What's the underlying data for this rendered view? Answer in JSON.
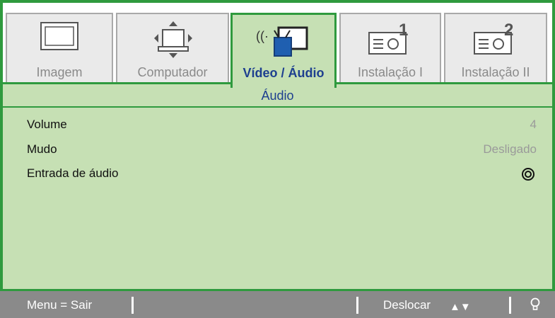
{
  "tabs": [
    {
      "label": "Imagem",
      "icon": "monitor-icon",
      "active": false
    },
    {
      "label": "Computador",
      "icon": "computer-icon",
      "active": false
    },
    {
      "label": "Vídeo / Áudio",
      "icon": "video-audio-icon",
      "active": true
    },
    {
      "label": "Instalação I",
      "icon": "projector-setup-1-icon",
      "active": false
    },
    {
      "label": "Instalação II",
      "icon": "projector-setup-2-icon",
      "active": false
    }
  ],
  "section": {
    "title": "Áudio"
  },
  "menu": [
    {
      "name": "Volume",
      "value": "4"
    },
    {
      "name": "Mudo",
      "value": "Desligado"
    },
    {
      "name": "Entrada de áudio",
      "value": ""
    }
  ],
  "statusbar": {
    "exit_label": "Menu = Sair",
    "move_label": "Deslocar",
    "arrows": "▲▼"
  },
  "colors": {
    "accent": "#2f9a3e",
    "panel_bg": "#c6e0b4",
    "active_text": "#1d3f8f",
    "status_bg": "#8a8a8a"
  }
}
